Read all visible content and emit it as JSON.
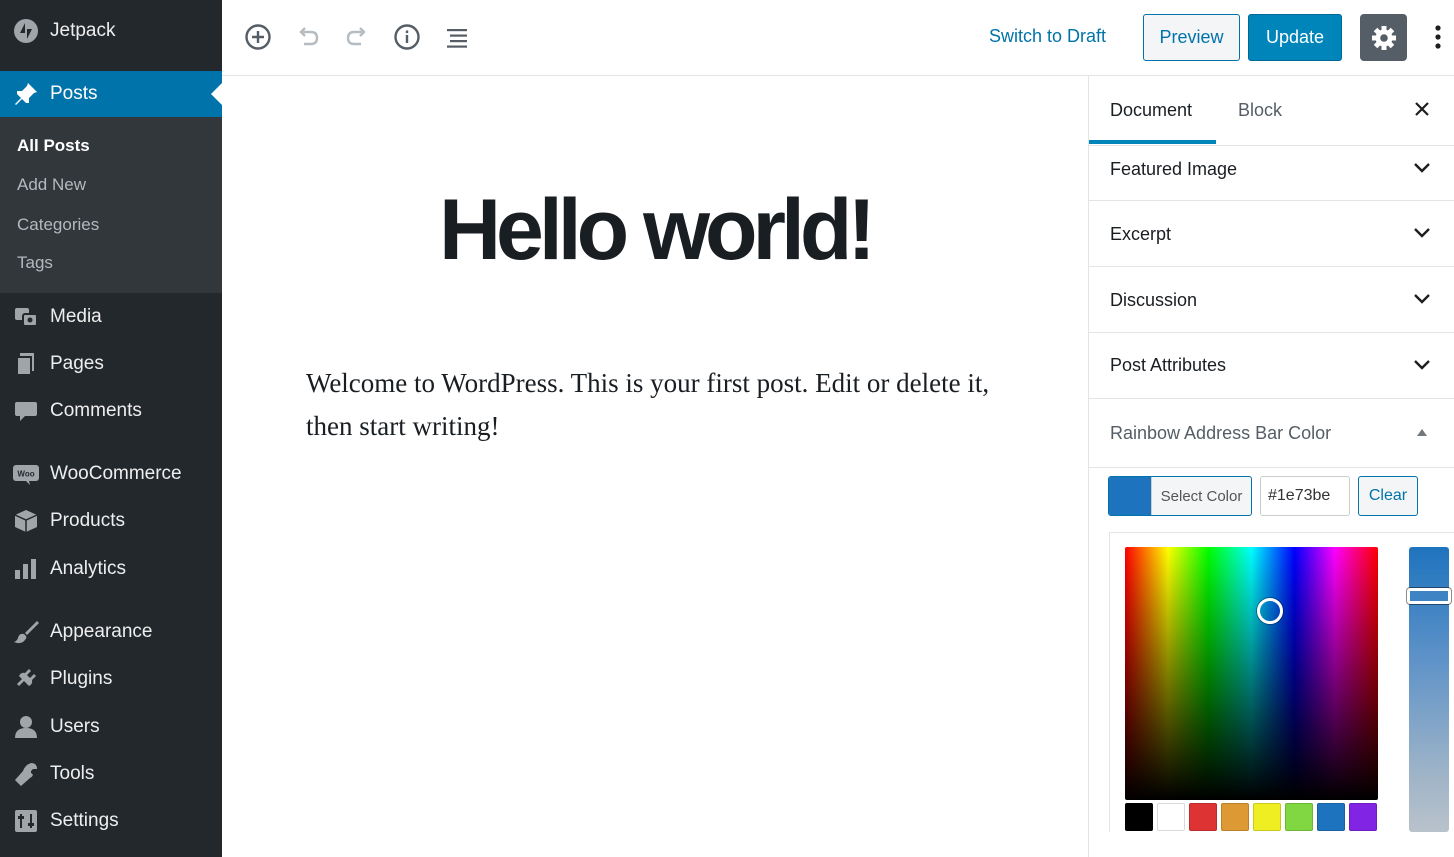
{
  "sidebar": {
    "brand": "Jetpack",
    "active_item": "Posts",
    "submenu": [
      "All Posts",
      "Add New",
      "Categories",
      "Tags"
    ],
    "items": [
      "Media",
      "Pages",
      "Comments",
      "WooCommerce",
      "Products",
      "Analytics",
      "Appearance",
      "Plugins",
      "Users",
      "Tools",
      "Settings"
    ],
    "woo_badge": "Woo"
  },
  "toolbar": {
    "add_block_icon": "plus-circle-icon",
    "undo_icon": "undo-icon",
    "redo_icon": "redo-icon",
    "info_icon": "info-icon",
    "outline_icon": "list-icon",
    "switch_to_draft": "Switch to Draft",
    "preview": "Preview",
    "update": "Update",
    "settings_icon": "gear-icon",
    "more_icon": "kebab-icon"
  },
  "post": {
    "title": "Hello world!",
    "body": "Welcome to WordPress. This is your first post. Edit or delete it, then start writing!"
  },
  "panel": {
    "tabs": [
      "Document",
      "Block"
    ],
    "active_tab": "Document",
    "sections": [
      "Featured Image",
      "Excerpt",
      "Discussion",
      "Post Attributes",
      "Rainbow Address Bar Color"
    ],
    "color": {
      "select_label": "Select Color",
      "hex_value": "#1e73be",
      "clear_label": "Clear",
      "current": "#1e73be",
      "palette": [
        "#000000",
        "#ffffff",
        "#dd3333",
        "#dd9933",
        "#eeee22",
        "#81d742",
        "#1e73be",
        "#8224e3"
      ]
    }
  },
  "colors": {
    "sidebar_bg": "#23282d",
    "accent": "#0073aa",
    "primary_button": "#0085ba"
  }
}
